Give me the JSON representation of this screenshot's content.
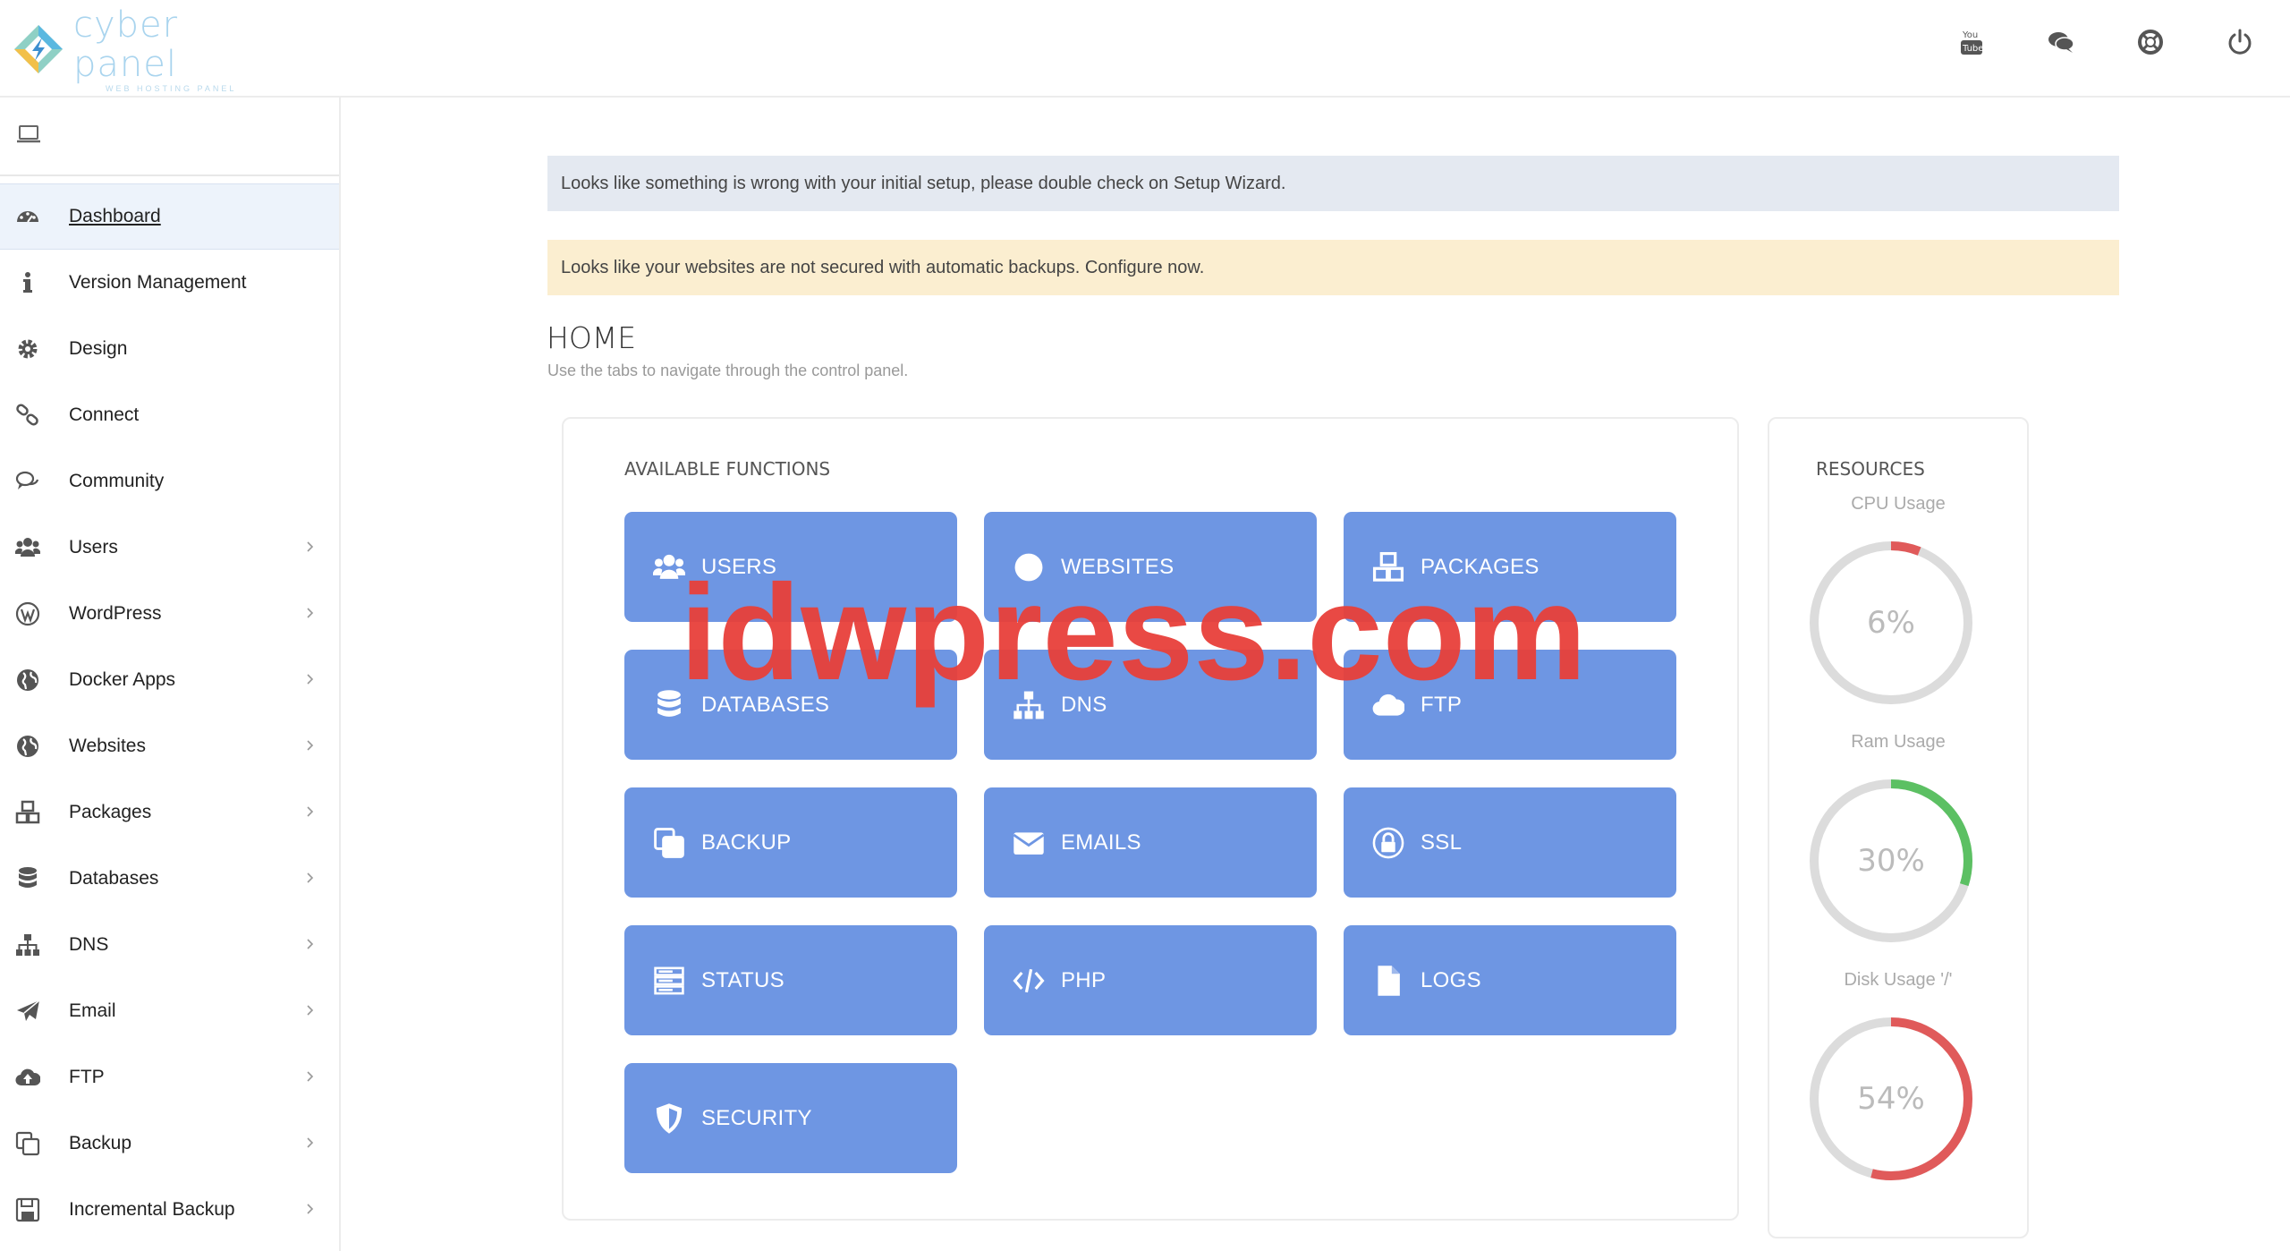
{
  "brand": {
    "name": "cyber panel",
    "tagline": "WEB HOSTING PANEL"
  },
  "header": {
    "icons": [
      "youtube-icon",
      "chat-icon",
      "support-icon",
      "power-icon"
    ]
  },
  "sidebar": {
    "items": [
      {
        "label": "Dashboard",
        "icon": "dashboard-icon",
        "active": true,
        "chevron": false
      },
      {
        "label": "Version Management",
        "icon": "info-icon",
        "chevron": false
      },
      {
        "label": "Design",
        "icon": "gear-icon",
        "chevron": false
      },
      {
        "label": "Connect",
        "icon": "link-icon",
        "chevron": false
      },
      {
        "label": "Community",
        "icon": "comments-icon",
        "chevron": false
      },
      {
        "label": "Users",
        "icon": "users-icon",
        "chevron": true
      },
      {
        "label": "WordPress",
        "icon": "wordpress-icon",
        "chevron": true
      },
      {
        "label": "Docker Apps",
        "icon": "globe-icon",
        "chevron": true
      },
      {
        "label": "Websites",
        "icon": "globe-icon",
        "chevron": true
      },
      {
        "label": "Packages",
        "icon": "cubes-icon",
        "chevron": true
      },
      {
        "label": "Databases",
        "icon": "database-icon",
        "chevron": true
      },
      {
        "label": "DNS",
        "icon": "sitemap-icon",
        "chevron": true
      },
      {
        "label": "Email",
        "icon": "paper-plane-icon",
        "chevron": true
      },
      {
        "label": "FTP",
        "icon": "cloud-upload-icon",
        "chevron": true
      },
      {
        "label": "Backup",
        "icon": "copy-icon",
        "chevron": true
      },
      {
        "label": "Incremental Backup",
        "icon": "save-icon",
        "chevron": true
      }
    ]
  },
  "alerts": {
    "setup": "Looks like something is wrong with your initial setup, please double check on Setup Wizard.",
    "backup": "Looks like your websites are not secured with automatic backups. Configure now."
  },
  "home": {
    "title": "HOME",
    "subtitle": "Use the tabs to navigate through the control panel."
  },
  "functions": {
    "title": "AVAILABLE FUNCTIONS",
    "tiles": [
      {
        "label": "USERS",
        "icon": "users-icon"
      },
      {
        "label": "WEBSITES",
        "icon": "globe-icon"
      },
      {
        "label": "PACKAGES",
        "icon": "cubes-icon"
      },
      {
        "label": "DATABASES",
        "icon": "database-icon"
      },
      {
        "label": "DNS",
        "icon": "sitemap-icon"
      },
      {
        "label": "FTP",
        "icon": "cloud-upload-icon"
      },
      {
        "label": "BACKUP",
        "icon": "copy-icon"
      },
      {
        "label": "EMAILS",
        "icon": "envelope-icon"
      },
      {
        "label": "SSL",
        "icon": "lock-icon"
      },
      {
        "label": "STATUS",
        "icon": "server-icon"
      },
      {
        "label": "PHP",
        "icon": "code-icon"
      },
      {
        "label": "LOGS",
        "icon": "file-icon"
      },
      {
        "label": "SECURITY",
        "icon": "shield-icon"
      }
    ]
  },
  "resources": {
    "title": "RESOURCES",
    "gauges": [
      {
        "label": "CPU Usage",
        "value": "6%",
        "percent": 6,
        "color": "#e05a5a"
      },
      {
        "label": "Ram Usage",
        "value": "30%",
        "percent": 30,
        "color": "#5cc063"
      },
      {
        "label": "Disk Usage '/'",
        "value": "54%",
        "percent": 54,
        "color": "#e05a5a"
      }
    ]
  },
  "watermark": "idwpress.com",
  "colors": {
    "tile": "#6e96e3",
    "active_bg": "#edf3fb",
    "alert_info": "#e4e9f1",
    "alert_warning": "#fbeed0"
  }
}
